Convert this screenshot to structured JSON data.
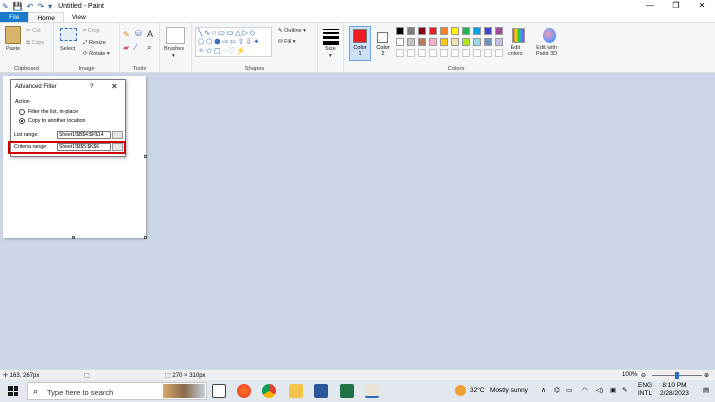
{
  "window": {
    "title": "Untitled - Paint"
  },
  "tabs": [
    "File",
    "Home",
    "View"
  ],
  "ribbon": {
    "clipboard": {
      "paste": "Paste",
      "cut": "Cut",
      "copy": "Copy",
      "label": "Clipboard"
    },
    "image": {
      "select": "Select",
      "crop": "Crop",
      "resize": "Resize",
      "rotate": "Rotate",
      "label": "Image"
    },
    "tools": {
      "label": "Tools"
    },
    "brushes": {
      "label": "Brushes"
    },
    "shapes": {
      "outline": "Outline",
      "fill": "Fill",
      "label": "Shapes"
    },
    "size": {
      "label": "Size"
    },
    "colors": {
      "color1": "Color\n1",
      "color1_a": "Color",
      "color1_b": "1",
      "color2_a": "Color",
      "color2_b": "2",
      "edit": "Edit colors",
      "edit_a": "Edit",
      "edit_b": "colors",
      "paint3d_a": "Edit with",
      "paint3d_b": "Paint 3D",
      "label": "Colors",
      "color1_value": "#ed1c24",
      "color2_value": "#ffffff",
      "palette_row1": [
        "#000000",
        "#7f7f7f",
        "#880015",
        "#ed1c24",
        "#ff7f27",
        "#fff200",
        "#22b14c",
        "#00a2e8",
        "#3f48cc",
        "#a349a4"
      ],
      "palette_row2": [
        "#ffffff",
        "#c3c3c3",
        "#b97a57",
        "#ffaec9",
        "#ffc90e",
        "#efe4b0",
        "#b5e61d",
        "#99d9ea",
        "#7092be",
        "#c8bfe7"
      ]
    }
  },
  "dialog": {
    "title": "Advanced Filter",
    "help": "?",
    "close": "✕",
    "action_label": "Action",
    "option1": "Filter the list, in-place",
    "option2": "Copy to another location",
    "list_range_label": "List range:",
    "list_range_value": "Sheet1!$B$4:$F$14",
    "criteria_range_label": "Criteria range:",
    "criteria_range_value": "Sheet1!$I$5:$K$6"
  },
  "status": {
    "cursor": "163, 267px",
    "size": "270 × 310px",
    "zoom": "100%"
  },
  "taskbar": {
    "search_placeholder": "Type here to search",
    "weather_temp": "32°C",
    "weather_text": "Mostly sunny",
    "lang1": "ENG",
    "lang2": "INTL",
    "time": "8:10 PM",
    "date": "2/28/2023"
  }
}
